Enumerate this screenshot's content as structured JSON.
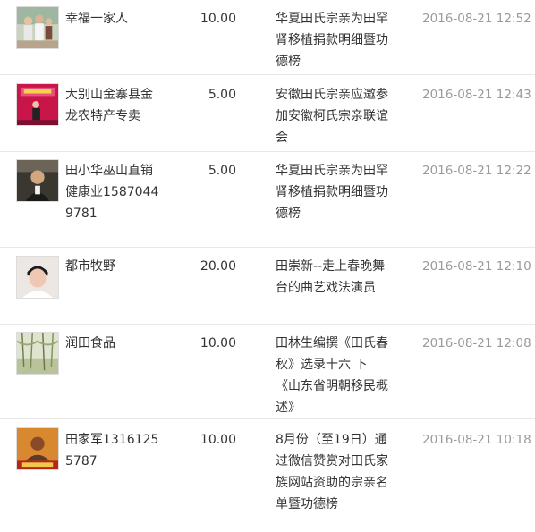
{
  "donations": [
    {
      "avatar": "family-photo-avatar",
      "name": "幸福一家人",
      "amount": "10.00",
      "project": "华夏田氏宗亲为田罕肾移植捐款明细暨功德榜",
      "time": "2016-08-21 12:52"
    },
    {
      "avatar": "banner-stage-avatar",
      "name": "大别山金寨县金龙农特产专卖",
      "amount": "5.00",
      "project": "安徽田氏宗亲应邀参加安徽柯氏宗亲联谊会",
      "time": "2016-08-21 12:43"
    },
    {
      "avatar": "man-portrait-avatar",
      "name": "田小华巫山直销健康业15870449781",
      "amount": "5.00",
      "project": "华夏田氏宗亲为田罕肾移植捐款明细暨功德榜",
      "time": "2016-08-21 12:22"
    },
    {
      "avatar": "young-man-avatar",
      "name": "都市牧野",
      "amount": "20.00",
      "project": "田崇新--走上春晚舞台的曲艺戏法演员",
      "time": "2016-08-21 12:10"
    },
    {
      "avatar": "willow-landscape-avatar",
      "name": "润田食品",
      "amount": "10.00",
      "project": "田林生编撰《田氏春秋》选录十六 下《山东省明朝移民概述》",
      "time": "2016-08-21 12:08"
    },
    {
      "avatar": "poster-portrait-avatar",
      "name": "田家军13161255787",
      "amount": "10.00",
      "project": "8月份（至19日）通过微信赞赏对田氏家族网站资助的宗亲名单暨功德榜",
      "time": "2016-08-21 10:18"
    }
  ]
}
